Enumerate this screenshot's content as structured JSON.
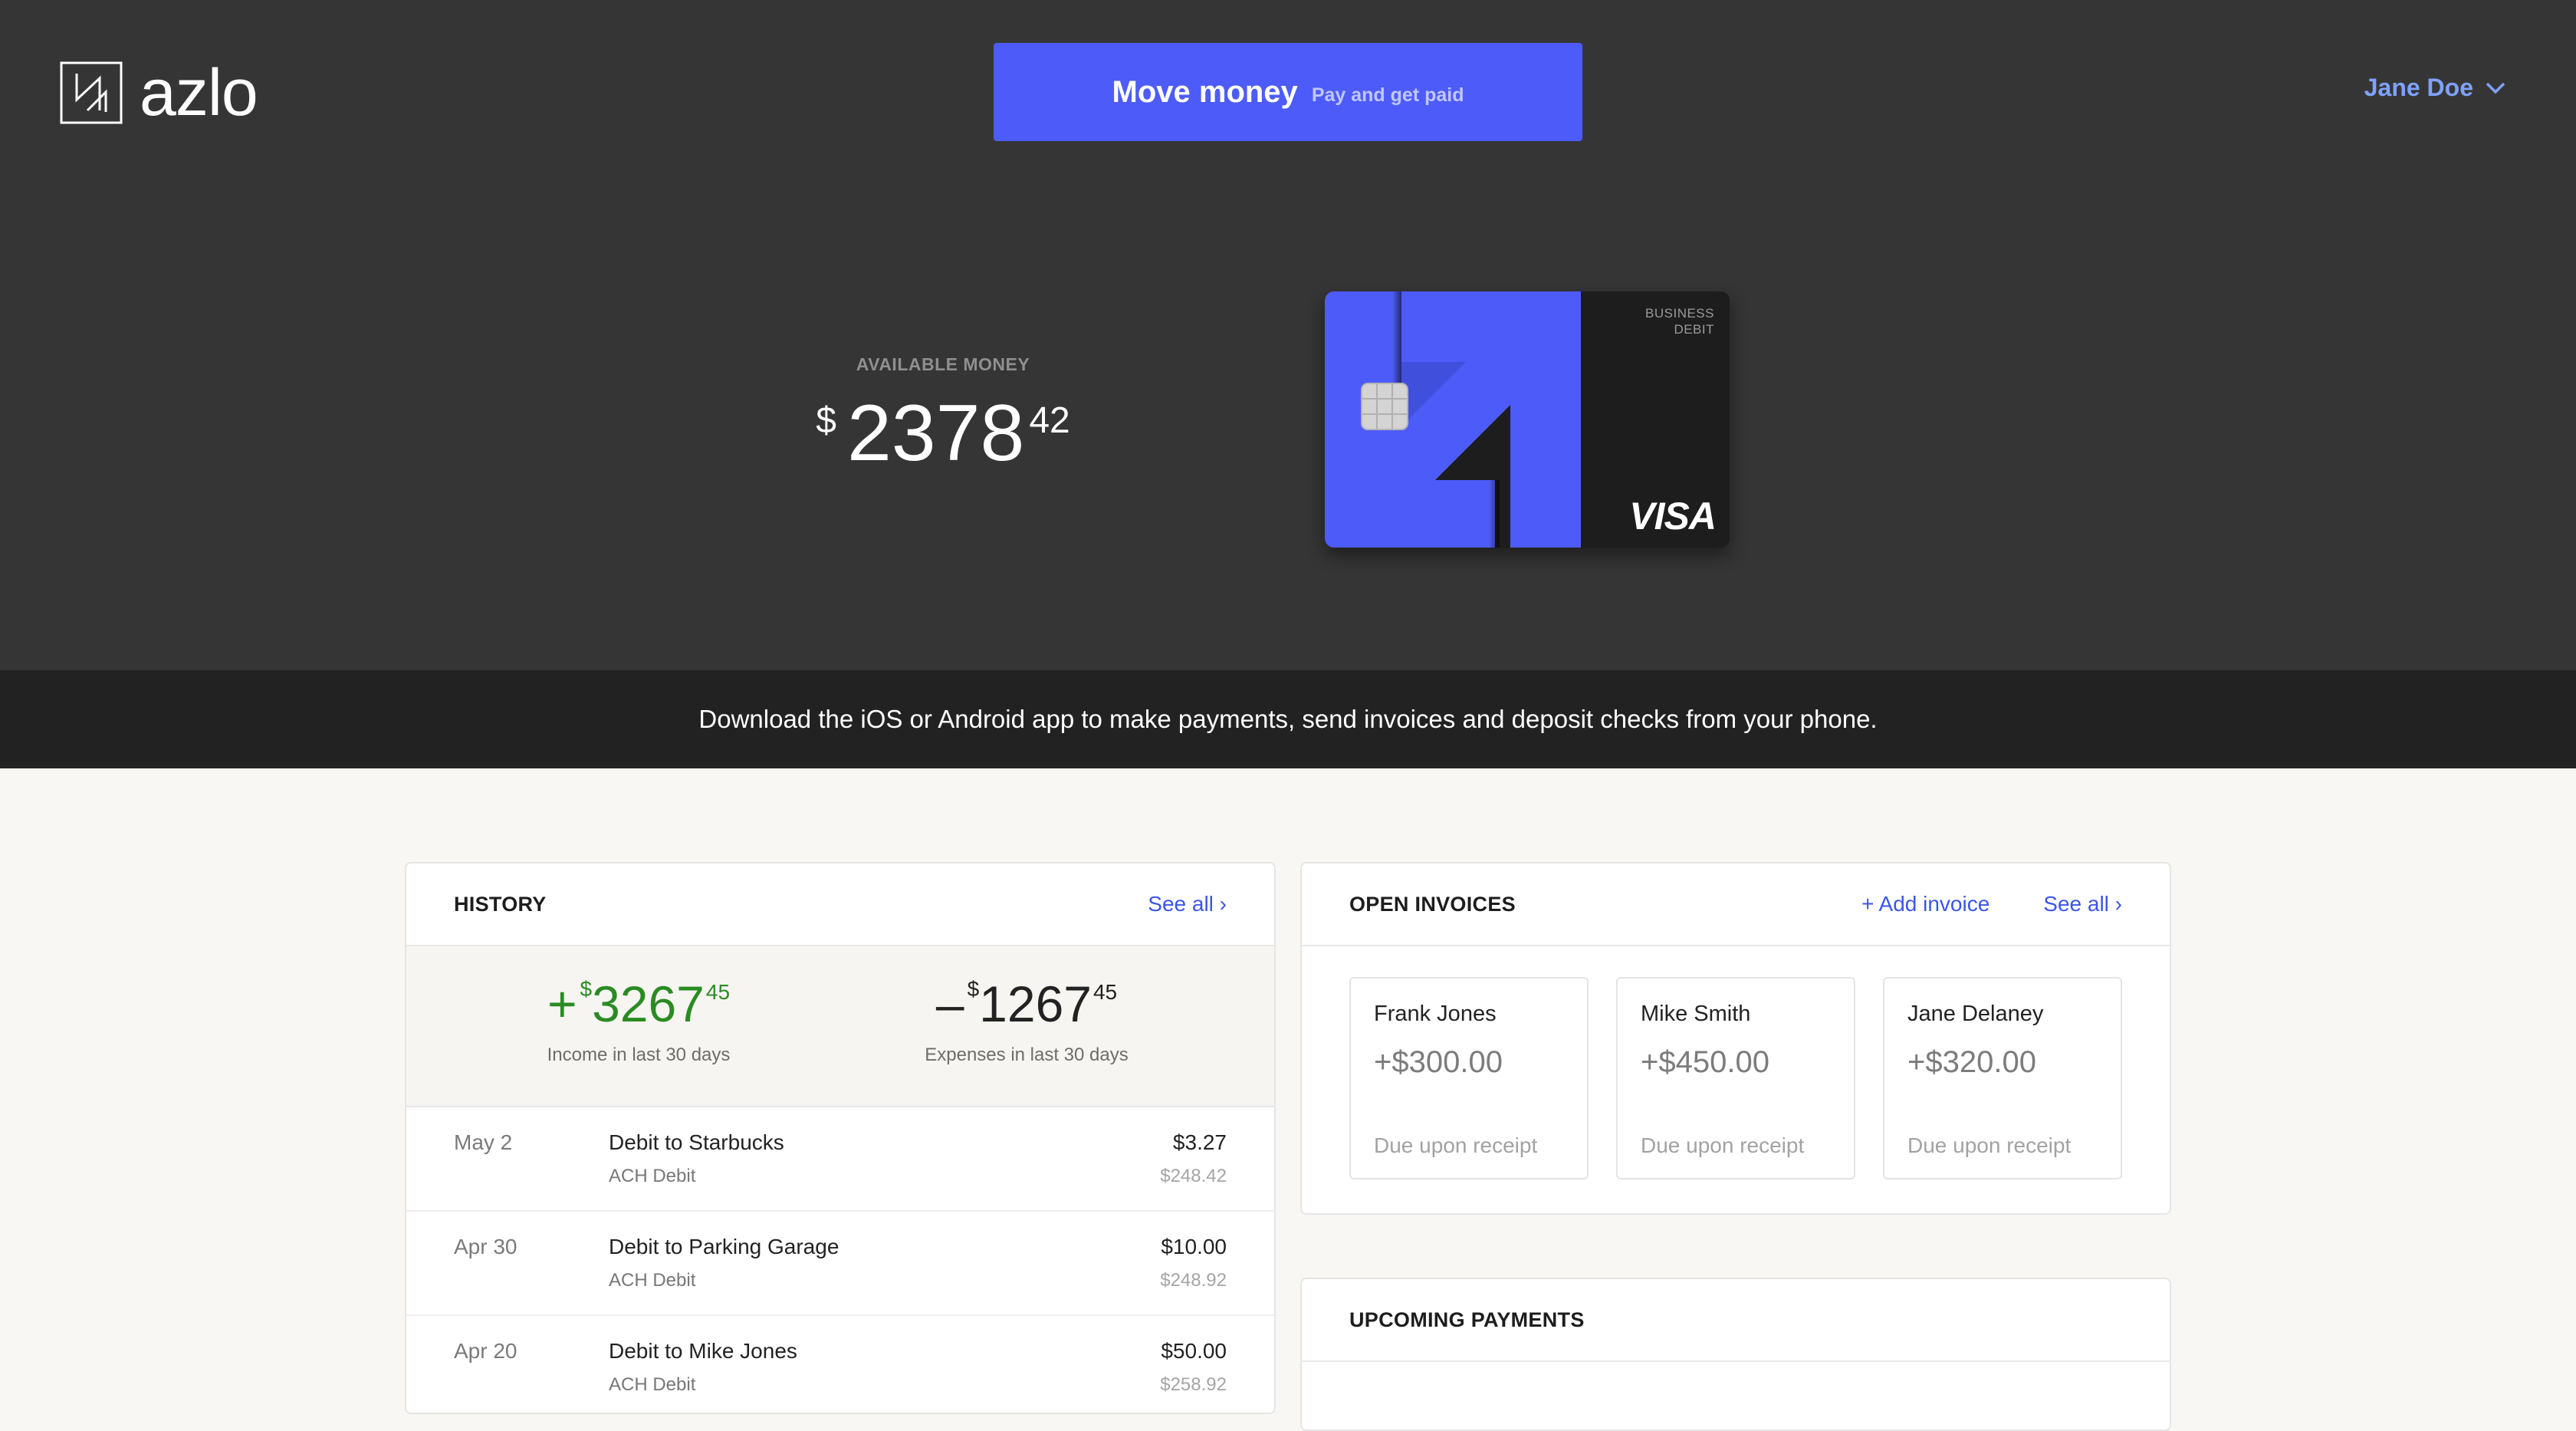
{
  "brand": {
    "name": "azlo"
  },
  "header": {
    "move_money": {
      "label": "Move money",
      "sublabel": "Pay and get paid"
    },
    "user": {
      "name": "Jane Doe"
    }
  },
  "balance": {
    "label": "AVAILABLE MONEY",
    "currency": "$",
    "whole": "2378",
    "cents": "42"
  },
  "card": {
    "type_line1": "BUSINESS",
    "type_line2": "DEBIT",
    "network": "VISA"
  },
  "banner": {
    "text": "Download the iOS or Android app to make payments, send invoices and deposit checks from your phone."
  },
  "history": {
    "title": "HISTORY",
    "see_all": "See all ›",
    "income": {
      "sign": "+",
      "currency": "$",
      "whole": "3267",
      "cents": "45",
      "caption": "Income in last 30 days"
    },
    "expenses": {
      "sign": "–",
      "currency": "$",
      "whole": "1267",
      "cents": "45",
      "caption": "Expenses in last 30 days"
    },
    "transactions": [
      {
        "date": "May 2",
        "name": "Debit to Starbucks",
        "kind": "ACH Debit",
        "amount": "$3.27",
        "balance": "$248.42"
      },
      {
        "date": "Apr 30",
        "name": "Debit to Parking Garage",
        "kind": "ACH Debit",
        "amount": "$10.00",
        "balance": "$248.92"
      },
      {
        "date": "Apr 20",
        "name": "Debit to Mike Jones",
        "kind": "ACH Debit",
        "amount": "$50.00",
        "balance": "$258.92"
      }
    ]
  },
  "invoices": {
    "title": "OPEN INVOICES",
    "add": "+ Add invoice",
    "see_all": "See all ›",
    "items": [
      {
        "name": "Frank Jones",
        "amount": "+$300.00",
        "due": "Due upon receipt"
      },
      {
        "name": "Mike Smith",
        "amount": "+$450.00",
        "due": "Due upon receipt"
      },
      {
        "name": "Jane Delaney",
        "amount": "+$320.00",
        "due": "Due upon receipt"
      }
    ]
  },
  "upcoming": {
    "title": "UPCOMING PAYMENTS"
  },
  "colors": {
    "hero_bg": "#363535",
    "accent": "#4d5cf8",
    "link": "#3b56e8",
    "income": "#2b8b23",
    "banner_bg": "#222222"
  }
}
